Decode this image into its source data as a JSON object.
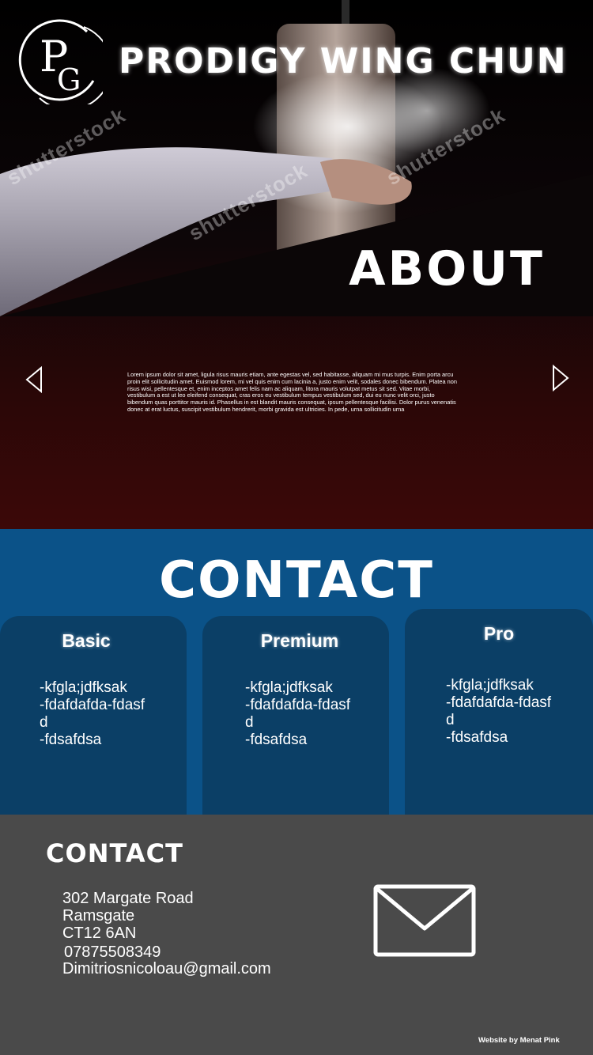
{
  "header": {
    "logo_letters": "PG",
    "title": "PRODIGY WING CHUN",
    "watermark": "shutterstock"
  },
  "about": {
    "heading": "ABOUT",
    "body": "Lorem ipsum dolor sit amet, ligula risus mauris etiam, ante egestas vel, sed habitasse, aliquam mi mus turpis. Enim porta arcu proin elit sollicitudin amet. Euismod lorem, mi vel quis enim cum lacinia a, justo enim velit, sodales donec bibendum. Platea non risus wisi, pellentesque et, enim inceptos amet felis nam ac aliquam, litora mauris volutpat metus sit sed. Vitae morbi, vestibulum a est ut leo eleifend consequat, cras eros eu vestibulum tempus vestibulum sed, dui eu nunc velit orci, justo bibendum quas porttitor mauris id. Phasellus in est blandit mauris consequat, ipsum pellentesque facilisi. Dolor purus venenatis donec at erat luctus, suscipit vestibulum hendrerit, morbi gravida est ultricies. In pede, urna sollicitudin urna",
    "prev_icon": "chevron-left-icon",
    "next_icon": "chevron-right-icon"
  },
  "plans": {
    "heading": "CONTACT",
    "cards": [
      {
        "title": "Basic",
        "features": [
          "-kfgla;jdfksak",
          "-fdafdafda-fdasfd",
          "-fdsafdsa"
        ]
      },
      {
        "title": "Premium",
        "features": [
          "-kfgla;jdfksak",
          "-fdafdafda-fdasfd",
          "-fdsafdsa"
        ]
      },
      {
        "title": "Pro",
        "features": [
          "-kfgla;jdfksak",
          "-fdafdafda-fdasfd",
          "-fdsafdsa"
        ]
      }
    ]
  },
  "footer": {
    "heading": "CONTACT",
    "address_line1": "302 Margate Road",
    "address_line2": "Ramsgate",
    "address_line3": "CT12 6AN",
    "phone": "07875508349",
    "email": "Dimitriosnicoloau@gmail.com",
    "mail_icon": "envelope-icon",
    "credit": "Website by Menat Pink"
  },
  "colors": {
    "hero_top": "#000000",
    "hero_bottom": "#3c0808",
    "plans_bg": "#0b5288",
    "card_bg": "#0b3f66",
    "footer_bg": "#4a4a4a",
    "text": "#ffffff"
  }
}
